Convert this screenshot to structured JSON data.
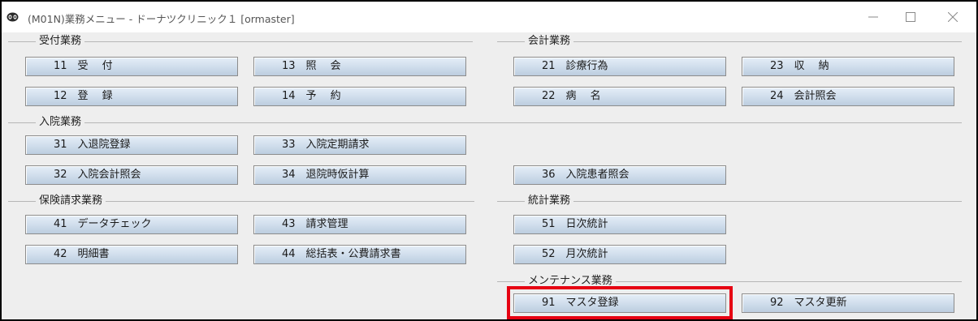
{
  "window": {
    "title": "(M01N)業務メニュー - ドーナツクリニック１ [ormaster]"
  },
  "groups": {
    "reception": "受付業務",
    "accounting": "会計業務",
    "inpatient": "入院業務",
    "insurance": "保険請求業務",
    "statistics": "統計業務",
    "maintenance": "メンテナンス業務"
  },
  "buttons": {
    "b11": "11　受　 付",
    "b12": "12　登　 録",
    "b13": "13　照　 会",
    "b14": "14　予　 約",
    "b21": "21　診療行為",
    "b22": "22　病　 名",
    "b23": "23　収　 納",
    "b24": "24　会計照会",
    "b31": "31　入退院登録",
    "b32": "32　入院会計照会",
    "b33": "33　入院定期請求",
    "b34": "34　退院時仮計算",
    "b36": "36　入院患者照会",
    "b41": "41　データチェック",
    "b42": "42　明細書",
    "b43": "43　請求管理",
    "b44": "44　総括表・公費請求書",
    "b51": "51　日次統計",
    "b52": "52　月次統計",
    "b91": "91　マスタ登録",
    "b92": "92　マスタ更新"
  },
  "highlight": {
    "target": "b91",
    "color": "#e60012"
  },
  "icons": {
    "app": "orca-app-icon",
    "minimize": "minimize-icon",
    "maximize": "maximize-icon",
    "close": "close-icon"
  }
}
